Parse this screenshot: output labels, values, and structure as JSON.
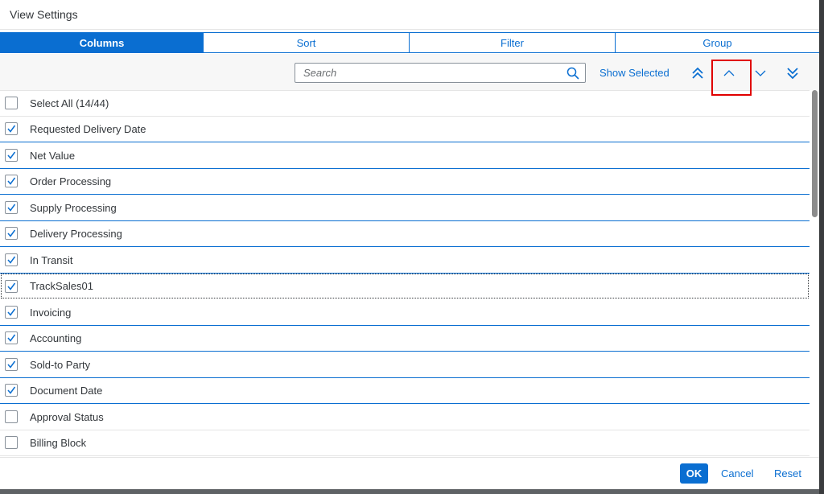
{
  "dialog": {
    "title": "View Settings"
  },
  "tabs": [
    {
      "label": "Columns",
      "active": true
    },
    {
      "label": "Sort",
      "active": false
    },
    {
      "label": "Filter",
      "active": false
    },
    {
      "label": "Group",
      "active": false
    }
  ],
  "toolbar": {
    "search_placeholder": "Search",
    "search_value": "",
    "show_selected_label": "Show Selected",
    "icons": [
      "move-to-top-icon",
      "move-up-icon",
      "move-down-icon",
      "move-to-bottom-icon"
    ]
  },
  "list": {
    "items": [
      {
        "label": "Select All (14/44)",
        "checked": false
      },
      {
        "label": "Requested Delivery Date",
        "checked": true
      },
      {
        "label": "Net Value",
        "checked": true
      },
      {
        "label": "Order Processing",
        "checked": true
      },
      {
        "label": "Supply Processing",
        "checked": true
      },
      {
        "label": "Delivery Processing",
        "checked": true
      },
      {
        "label": "In Transit",
        "checked": true
      },
      {
        "label": "TrackSales01",
        "checked": true,
        "focused": true
      },
      {
        "label": "Invoicing",
        "checked": true
      },
      {
        "label": "Accounting",
        "checked": true
      },
      {
        "label": "Sold-to Party",
        "checked": true
      },
      {
        "label": "Document Date",
        "checked": true
      },
      {
        "label": "Approval Status",
        "checked": false
      },
      {
        "label": "Billing Block",
        "checked": false
      }
    ]
  },
  "footer": {
    "ok_label": "OK",
    "cancel_label": "Cancel",
    "reset_label": "Reset"
  },
  "colors": {
    "accent": "#0a6ed1",
    "highlight": "#e00000",
    "text": "#32363a"
  }
}
